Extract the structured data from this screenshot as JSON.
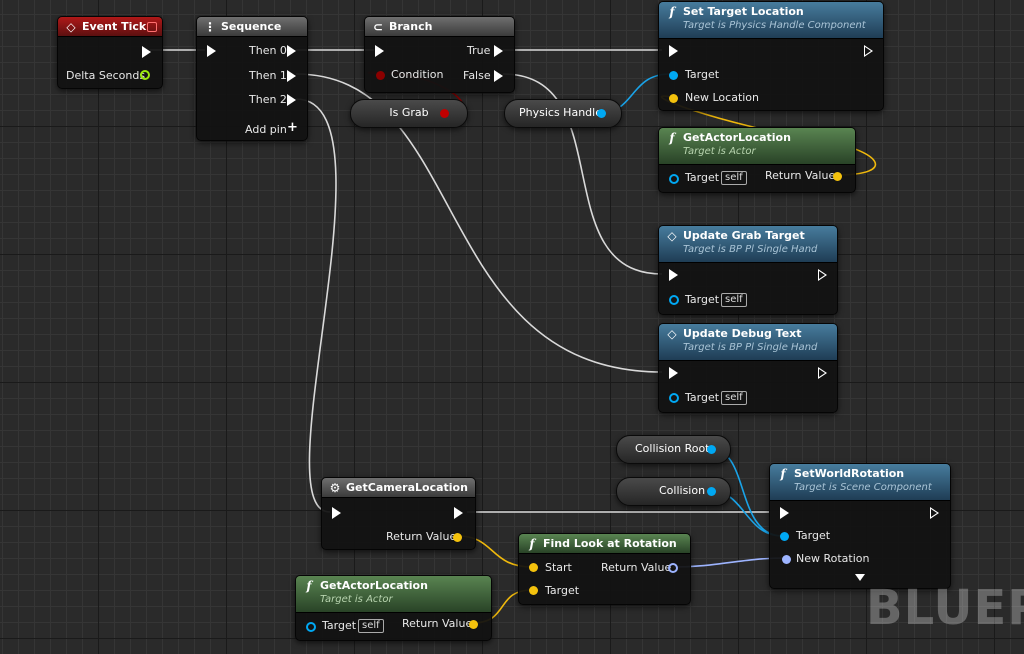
{
  "watermark": "BLUEPI",
  "colors": {
    "exec": "#ffffff",
    "bool": "#8c0000",
    "float": "#9be80c",
    "object": "#00a8f3",
    "vector": "#f4c20d",
    "rotator": "#9db4ff",
    "wire_exec": "#d9d9d9"
  },
  "nodes": {
    "event_tick": {
      "title": "Event Tick",
      "icon": "diamond-icon",
      "delta": "Delta Seconds"
    },
    "sequence": {
      "title": "Sequence",
      "icon": "sequence-icon",
      "then0": "Then 0",
      "then1": "Then 1",
      "then2": "Then 2",
      "add_pin": "Add pin",
      "add_icon": "+"
    },
    "branch": {
      "title": "Branch",
      "icon": "branch-icon",
      "condition": "Condition",
      "true": "True",
      "false": "False"
    },
    "is_grab": {
      "label": "Is Grab"
    },
    "physics_handle": {
      "label": "Physics Handle"
    },
    "set_target_location": {
      "title": "Set Target Location",
      "subtitle": "Target is Physics Handle Component",
      "icon": "f",
      "target": "Target",
      "new_location": "New Location"
    },
    "get_actor_location_1": {
      "title": "GetActorLocation",
      "subtitle": "Target is Actor",
      "icon": "f",
      "target": "Target",
      "self": "self",
      "return": "Return Value"
    },
    "update_grab_target": {
      "title": "Update Grab Target",
      "subtitle": "Target is BP Pl Single Hand",
      "icon": "diamond-icon",
      "target": "Target",
      "self": "self"
    },
    "update_debug_text": {
      "title": "Update Debug Text",
      "subtitle": "Target is BP Pl Single Hand",
      "icon": "diamond-icon",
      "target": "Target",
      "self": "self"
    },
    "collision_root": {
      "label": "Collision Root"
    },
    "collision": {
      "label": "Collision"
    },
    "set_world_rotation": {
      "title": "SetWorldRotation",
      "subtitle": "Target is Scene Component",
      "icon": "f",
      "target": "Target",
      "new_rotation": "New Rotation"
    },
    "get_camera_location": {
      "title": "GetCameraLocation",
      "icon": "gear-icon",
      "return": "Return Value"
    },
    "find_look_at_rotation": {
      "title": "Find Look at Rotation",
      "icon": "f",
      "start": "Start",
      "target": "Target",
      "return": "Return Value"
    },
    "get_actor_location_2": {
      "title": "GetActorLocation",
      "subtitle": "Target is Actor",
      "icon": "f",
      "target": "Target",
      "self": "self",
      "return": "Return Value"
    }
  }
}
